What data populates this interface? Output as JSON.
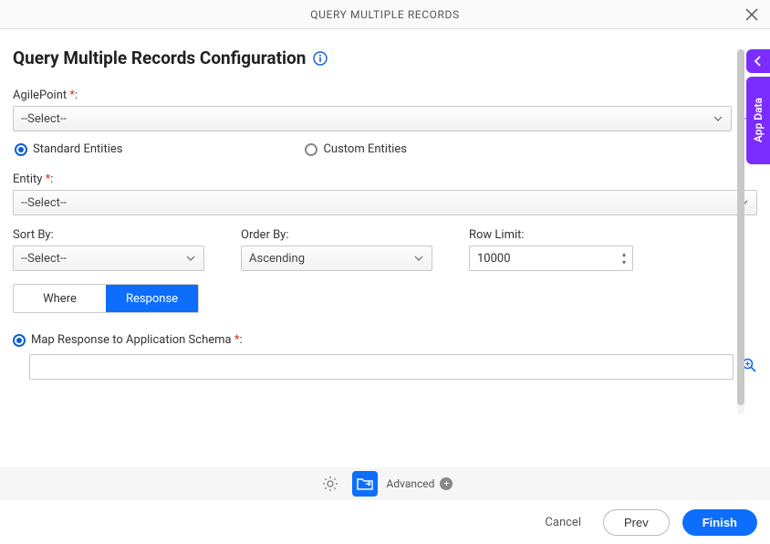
{
  "titlebar": {
    "text": "QUERY MULTIPLE RECORDS"
  },
  "pageTitle": "Query Multiple Records Configuration",
  "labels": {
    "agilepoint": "AgilePoint",
    "entity": "Entity",
    "sortBy": "Sort By:",
    "orderBy": "Order By:",
    "rowLimit": "Row Limit:",
    "mapResponse": "Map Response to Application Schema"
  },
  "selects": {
    "agilepoint": "--Select--",
    "entity": "--Select--",
    "sortBy": "--Select--",
    "orderBy": "Ascending"
  },
  "rowLimitValue": "10000",
  "radios": {
    "standard": "Standard Entities",
    "custom": "Custom Entities"
  },
  "tabs": {
    "where": "Where",
    "response": "Response"
  },
  "advancedLabel": "Advanced",
  "footer": {
    "cancel": "Cancel",
    "prev": "Prev",
    "finish": "Finish"
  },
  "sidePanelLabel": "App Data"
}
